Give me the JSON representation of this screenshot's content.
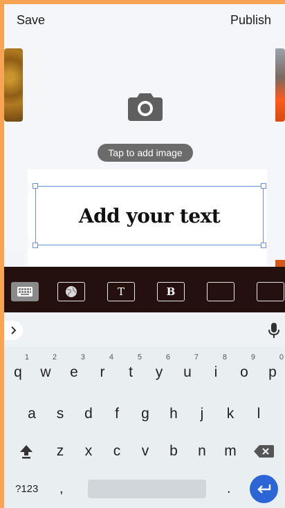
{
  "header": {
    "save_label": "Save",
    "publish_label": "Publish"
  },
  "canvas": {
    "add_image_label": "Tap to add image",
    "text_content": "Add your text"
  },
  "toolbar": {
    "buttons": [
      {
        "icon": "keyboard-icon",
        "label": ""
      },
      {
        "icon": "globe-icon",
        "label": ""
      },
      {
        "icon": "",
        "label": "T"
      },
      {
        "icon": "",
        "label": "B"
      },
      {
        "icon": "",
        "label": ""
      },
      {
        "icon": "",
        "label": ""
      }
    ]
  },
  "keyboard": {
    "row1": [
      {
        "key": "q",
        "hint": "1"
      },
      {
        "key": "w",
        "hint": "2"
      },
      {
        "key": "e",
        "hint": "3"
      },
      {
        "key": "r",
        "hint": "4"
      },
      {
        "key": "t",
        "hint": "5"
      },
      {
        "key": "y",
        "hint": "6"
      },
      {
        "key": "u",
        "hint": "7"
      },
      {
        "key": "i",
        "hint": "8"
      },
      {
        "key": "o",
        "hint": "9"
      },
      {
        "key": "p",
        "hint": "0"
      }
    ],
    "row2": [
      "a",
      "s",
      "d",
      "f",
      "g",
      "h",
      "j",
      "k",
      "l"
    ],
    "row3": [
      "z",
      "x",
      "c",
      "v",
      "b",
      "n",
      "m"
    ],
    "symbols_label": "?123",
    "comma": ",",
    "period": "."
  },
  "colors": {
    "background_frame": "#f7a455",
    "toolbar_bg": "#24100f",
    "selection_border": "#6d8fd4",
    "enter_key": "#2c66d6"
  }
}
